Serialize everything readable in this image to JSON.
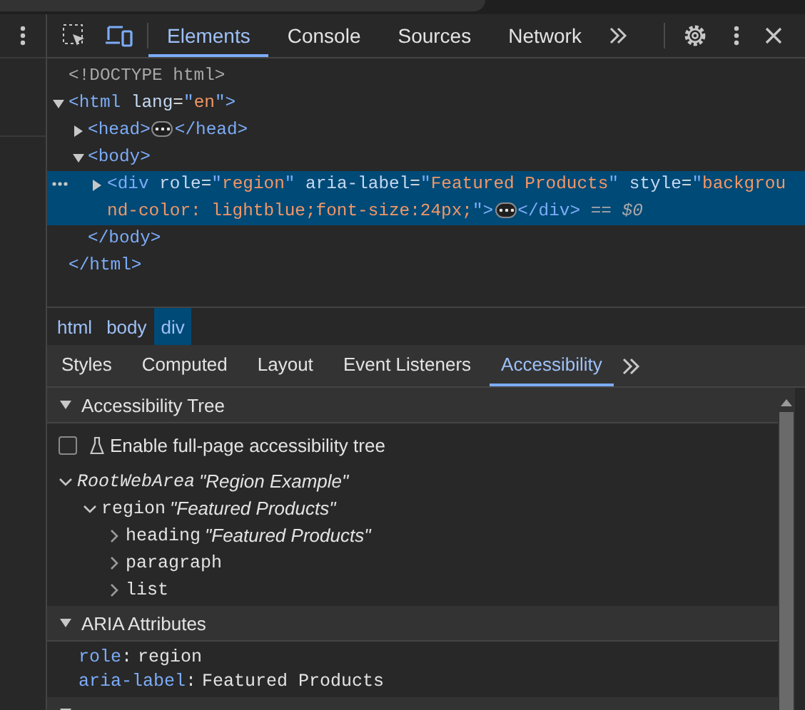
{
  "toolbar": {
    "tabs": [
      {
        "label": "Elements",
        "selected": true
      },
      {
        "label": "Console",
        "selected": false
      },
      {
        "label": "Sources",
        "selected": false
      },
      {
        "label": "Network",
        "selected": false
      }
    ]
  },
  "dom": [
    {
      "kind": "doctype",
      "text": "<!DOCTYPE html>"
    },
    {
      "kind": "element",
      "expanded": true,
      "selected": false,
      "tokens": [
        {
          "kind": "tag",
          "text": "<html "
        },
        {
          "kind": "attr",
          "text": "lang"
        },
        {
          "kind": "punct",
          "text": "="
        },
        {
          "kind": "tag",
          "text": "\""
        },
        {
          "kind": "value",
          "text": "en"
        },
        {
          "kind": "tag",
          "text": "\">"
        }
      ],
      "close": "</html>",
      "children": [
        {
          "kind": "element",
          "expanded": false,
          "selected": false,
          "tokens": [
            {
              "kind": "tag",
              "text": "<head>"
            }
          ],
          "close": "</head>"
        },
        {
          "kind": "element",
          "expanded": true,
          "selected": false,
          "tokens": [
            {
              "kind": "tag",
              "text": "<body>"
            }
          ],
          "close": "</body>",
          "children": [
            {
              "kind": "element",
              "expanded": false,
              "selected": true,
              "suffix": "== $0",
              "tokens": [
                {
                  "kind": "tag",
                  "text": "<div "
                },
                {
                  "kind": "attr",
                  "text": "role"
                },
                {
                  "kind": "punct",
                  "text": "="
                },
                {
                  "kind": "tag",
                  "text": "\""
                },
                {
                  "kind": "value",
                  "text": "region"
                },
                {
                  "kind": "tag",
                  "text": "\" "
                },
                {
                  "kind": "attr",
                  "text": "aria-label"
                },
                {
                  "kind": "punct",
                  "text": "="
                },
                {
                  "kind": "tag",
                  "text": "\""
                },
                {
                  "kind": "value",
                  "text": "Featured Products"
                },
                {
                  "kind": "tag",
                  "text": "\" "
                },
                {
                  "kind": "attr",
                  "text": "style"
                },
                {
                  "kind": "punct",
                  "text": "="
                },
                {
                  "kind": "tag",
                  "text": "\""
                },
                {
                  "kind": "value",
                  "text": "background-color: lightblue;font-size:24px;"
                },
                {
                  "kind": "tag",
                  "text": "\">"
                }
              ],
              "close": "</div>"
            }
          ]
        }
      ]
    }
  ],
  "breadcrumbs": [
    {
      "label": "html",
      "selected": false
    },
    {
      "label": "body",
      "selected": false
    },
    {
      "label": "div",
      "selected": true
    }
  ],
  "panel_tabs": [
    {
      "label": "Styles",
      "selected": false
    },
    {
      "label": "Computed",
      "selected": false
    },
    {
      "label": "Layout",
      "selected": false
    },
    {
      "label": "Event Listeners",
      "selected": false
    },
    {
      "label": "Accessibility",
      "selected": true
    }
  ],
  "accessibility": {
    "tree_section": {
      "title": "Accessibility Tree",
      "expanded": true
    },
    "full_page_option": {
      "label": "Enable full-page accessibility tree",
      "checked": false
    },
    "tree": [
      {
        "kind": "root",
        "role": "RootWebArea",
        "name": "\"Region Example\"",
        "expanded": true,
        "children": [
          {
            "kind": "role",
            "role": "region",
            "name": "\"Featured Products\"",
            "expanded": true,
            "children": [
              {
                "kind": "role",
                "role": "heading",
                "name": "\"Featured Products\"",
                "expanded": false
              },
              {
                "kind": "role",
                "role": "paragraph",
                "expanded": false
              },
              {
                "kind": "role",
                "role": "list",
                "expanded": false
              }
            ]
          }
        ]
      }
    ],
    "aria_section": {
      "title": "ARIA Attributes",
      "expanded": true
    },
    "attributes": [
      {
        "name": "role",
        "separator": ":",
        "value": "region"
      },
      {
        "name": "aria-label",
        "separator": ":",
        "value": "Featured Products"
      }
    ],
    "computed_section": {
      "expanded": true
    }
  }
}
